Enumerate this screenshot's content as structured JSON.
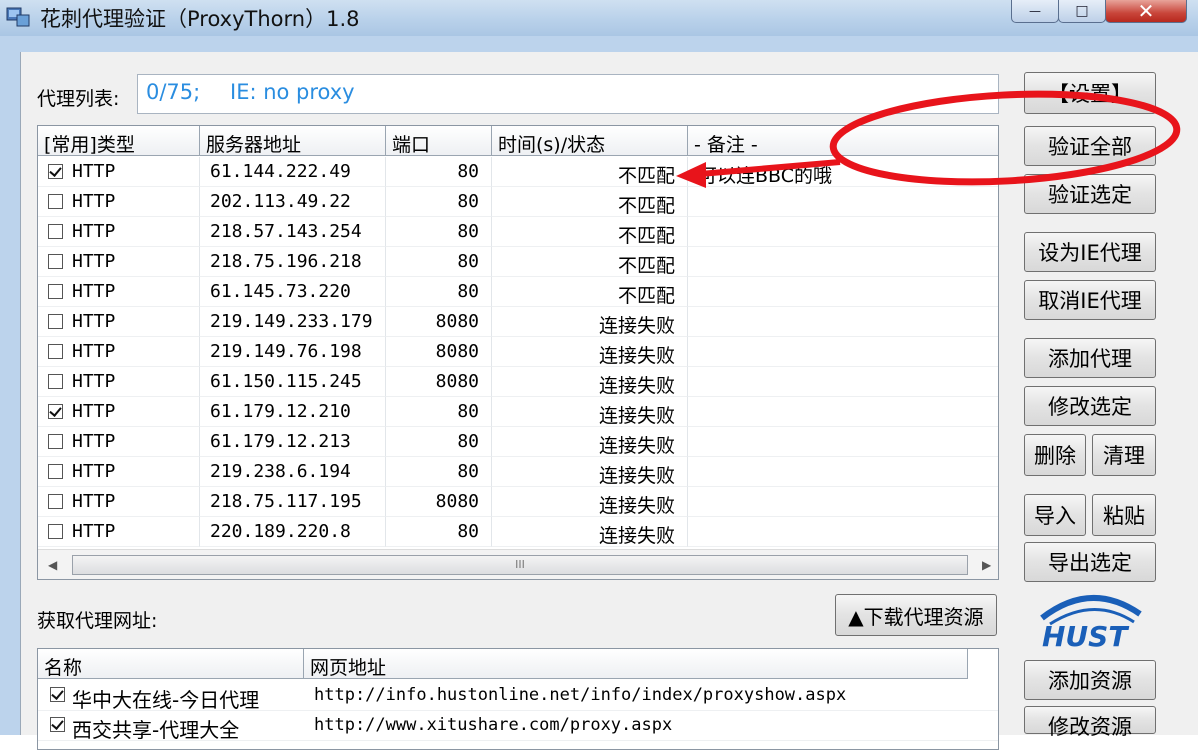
{
  "window": {
    "title": "花刺代理验证（ProxyThorn）1.8",
    "min_glyph": "—",
    "max_glyph": "□",
    "close_glyph": "✕"
  },
  "proxy_list": {
    "label": "代理列表:",
    "status_count": "0/75;",
    "status_ie": "IE: no proxy",
    "columns": [
      "[常用]类型",
      "服务器地址",
      "端口",
      "时间(s)/状态",
      "- 备注 -"
    ],
    "rows": [
      {
        "checked": true,
        "type": "HTTP",
        "address": "61.144.222.49",
        "port": "80",
        "status": "不匹配",
        "note": "可以连BBC的哦"
      },
      {
        "checked": false,
        "type": "HTTP",
        "address": "202.113.49.22",
        "port": "80",
        "status": "不匹配",
        "note": ""
      },
      {
        "checked": false,
        "type": "HTTP",
        "address": "218.57.143.254",
        "port": "80",
        "status": "不匹配",
        "note": ""
      },
      {
        "checked": false,
        "type": "HTTP",
        "address": "218.75.196.218",
        "port": "80",
        "status": "不匹配",
        "note": ""
      },
      {
        "checked": false,
        "type": "HTTP",
        "address": "61.145.73.220",
        "port": "80",
        "status": "不匹配",
        "note": ""
      },
      {
        "checked": false,
        "type": "HTTP",
        "address": "219.149.233.179",
        "port": "8080",
        "status": "连接失败",
        "note": ""
      },
      {
        "checked": false,
        "type": "HTTP",
        "address": "219.149.76.198",
        "port": "8080",
        "status": "连接失败",
        "note": ""
      },
      {
        "checked": false,
        "type": "HTTP",
        "address": "61.150.115.245",
        "port": "8080",
        "status": "连接失败",
        "note": ""
      },
      {
        "checked": true,
        "type": "HTTP",
        "address": "61.179.12.210",
        "port": "80",
        "status": "连接失败",
        "note": ""
      },
      {
        "checked": false,
        "type": "HTTP",
        "address": "61.179.12.213",
        "port": "80",
        "status": "连接失败",
        "note": ""
      },
      {
        "checked": false,
        "type": "HTTP",
        "address": "219.238.6.194",
        "port": "80",
        "status": "连接失败",
        "note": ""
      },
      {
        "checked": false,
        "type": "HTTP",
        "address": "218.75.117.195",
        "port": "8080",
        "status": "连接失败",
        "note": ""
      },
      {
        "checked": false,
        "type": "HTTP",
        "address": "220.189.220.8",
        "port": "80",
        "status": "连接失败",
        "note": ""
      }
    ],
    "hscroll_grip": "III"
  },
  "buttons": {
    "settings": "【设置】",
    "verify_all": "验证全部",
    "verify_selected": "验证选定",
    "set_ie_proxy": "设为IE代理",
    "cancel_ie_proxy": "取消IE代理",
    "add_proxy": "添加代理",
    "edit_selected": "修改选定",
    "delete": "删除",
    "clear": "清理",
    "import": "导入",
    "paste": "粘贴",
    "export_selected": "导出选定",
    "download_sources": "▲下载代理资源",
    "add_source": "添加资源",
    "edit_source": "修改资源"
  },
  "sources": {
    "label": "获取代理网址:",
    "columns": [
      "名称",
      "网页地址"
    ],
    "rows": [
      {
        "checked": true,
        "name": "华中大在线-今日代理",
        "url": "http://info.hustonline.net/info/index/proxyshow.aspx"
      },
      {
        "checked": true,
        "name": "西交共享-代理大全",
        "url": "http://www.xitushare.com/proxy.aspx"
      }
    ]
  },
  "logo": {
    "text": "HUST"
  },
  "colors": {
    "status_text": "#2a8de0",
    "annotation_red": "#e8141b",
    "title_bar": "#b9d1ea",
    "client_bg": "#f0f0f0"
  }
}
